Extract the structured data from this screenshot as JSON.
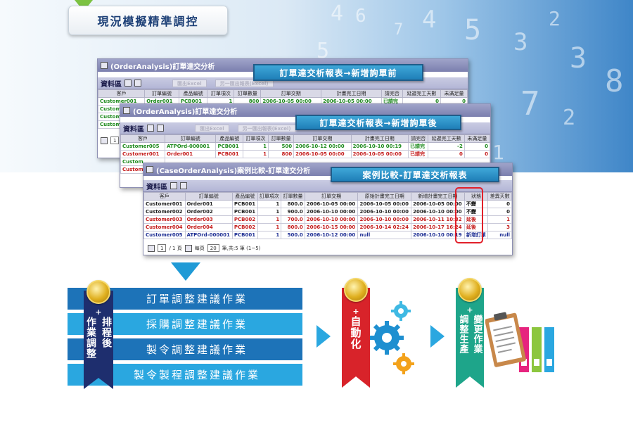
{
  "header": {
    "title": "現況模擬精準調控"
  },
  "window1": {
    "title": "(OrderAnalysis)訂單達交分析",
    "callout": "訂單達交析報表→新增詢單前",
    "section": "資料區",
    "buttons": [
      "匯出Excel",
      "另一匯出報表(Excel)"
    ],
    "headers": [
      "客戶",
      "訂單編號",
      "產品編號",
      "訂單項次",
      "訂單數量",
      "訂單交期",
      "計畫完工日期",
      "請完否",
      "延遲完工天數",
      "未滿足量"
    ],
    "row_prefixes": [
      "Customer001",
      "Custome",
      "Custome",
      "Custome"
    ],
    "row1": [
      "Customer001",
      "Order001",
      "PCB001",
      "1",
      "800",
      "2006-10-05 00:00",
      "2006-10-05 00:00",
      "已請完",
      "0",
      "0"
    ]
  },
  "window2": {
    "title": "(OrderAnalysis)訂單達交分析",
    "callout": "訂單達交析報表→新增詢單後",
    "section": "資料區",
    "buttons": [
      "匯出Excel",
      "另一匯出報表(Excel)"
    ],
    "headers": [
      "客戶",
      "訂單編號",
      "產品編號",
      "訂單項次",
      "訂單數量",
      "訂單交期",
      "計畫完工日期",
      "請完否",
      "延遲完工天數",
      "未滿足量"
    ],
    "rows": [
      [
        "Customer005",
        "ATPOrd-000001",
        "PCB001",
        "1",
        "500",
        "2006-10-12 00:00",
        "2006-10-10 00:19",
        "已請完",
        "-2",
        "0"
      ],
      [
        "Customer001",
        "Order001",
        "PCB001",
        "1",
        "800",
        "2006-10-05 00:00",
        "2006-10-05 00:00",
        "已請完",
        "0",
        "0"
      ]
    ],
    "row_prefixes": [
      "Custom",
      "Custom"
    ],
    "pager_page": "1"
  },
  "window3": {
    "title": "(CaseOrderAnalysis)案例比較-訂單達交分析",
    "callout": "案例比較-訂單達交析報表",
    "section": "資料區",
    "headers": [
      "客戶",
      "訂單編號",
      "產品編號",
      "訂單項次",
      "訂單數量",
      "訂單交期",
      "原始計畫完工日期",
      "新增計畫完工日期",
      "狀態",
      "差異天數"
    ],
    "rows": [
      [
        "Customer001",
        "Order001",
        "PCB001",
        "1",
        "800.0",
        "2006-10-05 00:00",
        "2006-10-05 00:00",
        "2006-10-05 00:00",
        "不變",
        "0"
      ],
      [
        "Customer002",
        "Order002",
        "PCB001",
        "1",
        "900.0",
        "2006-10-10 00:00",
        "2006-10-10 00:00",
        "2006-10-10 00:00",
        "不變",
        "0"
      ],
      [
        "Customer003",
        "Order003",
        "PCB002",
        "1",
        "700.0",
        "2006-10-10 00:00",
        "2006-10-10 00:00",
        "2006-10-11 10:32",
        "延後",
        "1"
      ],
      [
        "Customer004",
        "Order004",
        "PCB002",
        "1",
        "800.0",
        "2006-10-15 00:00",
        "2006-10-14 02:24",
        "2006-10-17 16:24",
        "延後",
        "3"
      ],
      [
        "Customer005",
        "ATPOrd-000001",
        "PCB001",
        "1",
        "500.0",
        "2006-10-12 00:00",
        "null",
        "2006-10-10 00:19",
        "新增訂單",
        "null"
      ]
    ],
    "pager": {
      "page": "1",
      "of": "/ 1 頁",
      "per": "每頁",
      "per_value": "20",
      "summary": "筆,共:5 筆 (1~5)"
    }
  },
  "flow": {
    "bars": [
      "訂單調整建議作業",
      "採購調整建議作業",
      "製令調整建議作業",
      "製令製程調整建議作業"
    ],
    "left_ribbon": {
      "plus": "+",
      "col1": "排程後",
      "col2": "作業調整"
    },
    "mid_ribbon": {
      "plus": "+",
      "text": "自動化"
    },
    "right_ribbon": {
      "plus": "+",
      "col1": "調整生產",
      "col2": "變更作業"
    }
  },
  "colors": {
    "accent": "#1d73b8",
    "light": "#2aa7e0",
    "red_ribbon": "#d8232a",
    "teal_ribbon": "#1ea58a",
    "navy_ribbon": "#1e2e6e"
  }
}
